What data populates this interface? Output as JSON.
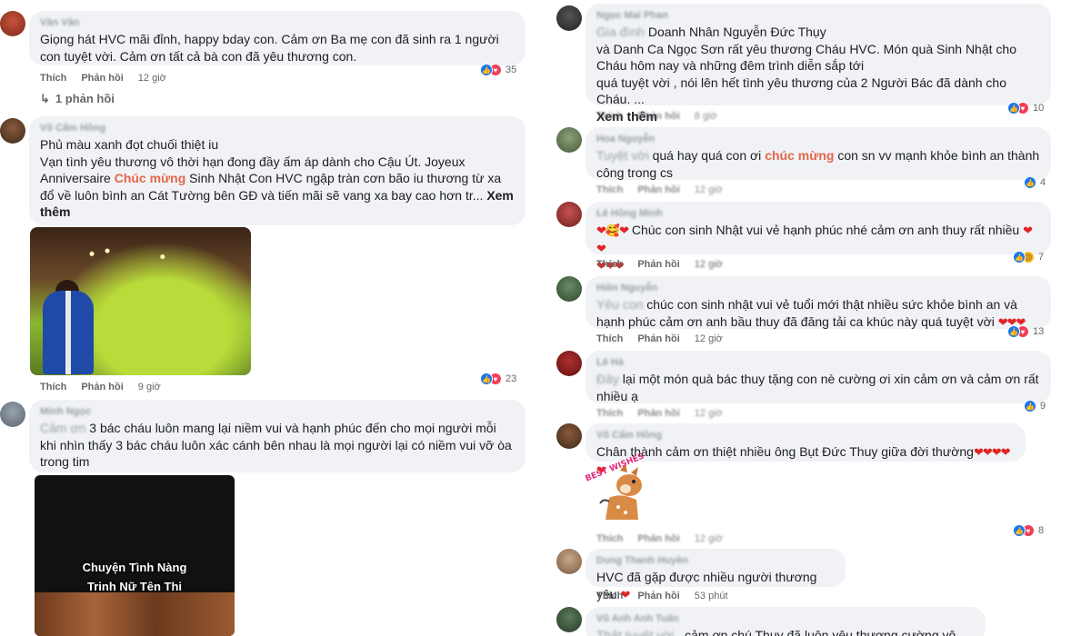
{
  "left_comments": {
    "c1": {
      "author": "Vân Vân",
      "text": "Giọng hát HVC mãi đỉnh, happy bday con. Cảm ơn Ba mẹ con đã sinh ra 1 người con tuyệt vời. Cảm ơn tất cả bà con đã yêu thương con.",
      "like_label": "Thích",
      "reply_label": "Phản hồi",
      "time": "12 giờ",
      "reaction_count": "35",
      "replies_label": "1 phản hồi"
    },
    "c2": {
      "author": "Võ Cẩm Hồng",
      "text_1": "Phủ màu xanh đọt chuối thiệt iu",
      "text_2": "Vạn tình yêu thương vô thời hạn đong đầy ấm áp dành cho Cậu Út. Joyeux Anniversaire ",
      "highlight": "Chúc mừng",
      "text_3": " Sinh Nhật Con HVC ngập tràn cơn bão iu thương từ xa đổ về luôn bình an Cát Tường bên GĐ và tiến mãi sẽ vang xa bay cao hơn tr... ",
      "see_more": "Xem thêm",
      "like_label": "Thích",
      "reply_label": "Phản hồi",
      "time": "9 giờ",
      "reaction_count": "23"
    },
    "c3": {
      "author": "Minh Ngọc",
      "blurred_word": "Cảm ơn",
      "text": " 3 bác cháu luôn mang lại niềm vui và hạnh phúc đến cho mọi người mỗi khi nhìn thấy 3 bác cháu luôn xác cánh bên nhau là mọi người lại có niềm vui vỡ òa trong tim",
      "video_caption_1": "Chuyện Tình Nàng",
      "video_caption_2": "Trinh Nữ Tên Thi"
    }
  },
  "right_comments": {
    "r1": {
      "author": "Ngọc Mai Phan",
      "blurred_prefix": "Gia đình",
      "text_1": " Doanh Nhân Nguyễn Đức Thụy",
      "text_2": "và Danh Ca Ngọc Sơn rất yêu thương Cháu HVC. Món quà Sinh Nhật cho Cháu hôm nay và những đêm trình diễn sắp tới",
      "text_3": "quá tuyệt vời , nói lên hết tình yêu thương của 2 Người Bác đã dành cho Cháu. ...",
      "see_more": "Xem thêm",
      "like_label": "Thích",
      "reply_label": "Phản hồi",
      "time": "8 giờ",
      "reaction_count": "10"
    },
    "r2": {
      "author": "Hoa Nguyễn",
      "blurred_prefix": "Tuyệt vời",
      "text_1": " quá hay quá con ơi ",
      "highlight": "chúc mừng",
      "text_2": " con sn vv mạnh khỏe bình an thành công trong cs",
      "like_label": "Thích",
      "reply_label": "Phản hồi",
      "time": "12 giờ",
      "reaction_count": "4"
    },
    "r3": {
      "author": "Lê Hồng Minh",
      "text": " Chúc con sinh Nhật vui vẻ hạnh phúc nhé cảm ơn anh thuy rất nhiều ",
      "like_label": "Thích",
      "reply_label": "Phản hồi",
      "time": "12 giờ",
      "reaction_count": "7"
    },
    "r4": {
      "author": "Hiền Nguyễn",
      "blurred_prefix": "Yêu con",
      "text": " chúc con sinh nhật vui vẻ tuổi mới thật nhiều sức khỏe bình an và hạnh phúc cảm ơn anh bầu thuy đã đăng tải ca khúc này quá tuyệt vời ",
      "like_label": "Thích",
      "reply_label": "Phản hồi",
      "time": "12 giờ",
      "reaction_count": "13"
    },
    "r5": {
      "author": "Lê Hà",
      "blurred_prefix": "Đây",
      "text": " lại một món quà bác thuy tặng con nè cường ơi xin cảm ơn và cảm ơn rất nhiều ạ",
      "like_label": "Thích",
      "reply_label": "Phản hồi",
      "time": "12 giờ",
      "reaction_count": "9"
    },
    "r6": {
      "author": "Võ Cẩm Hồng",
      "text": "Chân thành cảm ơn thiệt nhiều ông Bụt Đức Thuy giữa đời thường",
      "sticker_text": "BEST WISHES",
      "like_label": "Thích",
      "reply_label": "Phản hồi",
      "time": "12 giờ",
      "reaction_count": "8"
    },
    "r7": {
      "author": "Dung Thanh Huyền",
      "text": "HVC đã gặp được nhiều người thương yêu ",
      "like_label": "Thích",
      "reply_label": "Phản hồi",
      "time": "53 phút"
    },
    "r8": {
      "author": "Vũ Anh Anh Tuấn",
      "blurred_prefix": "Thật tuyệt vời",
      "text": "...cảm ơn chú Thuy đã luôn yêu thương cường vô điều kiện"
    }
  },
  "colors": {
    "bubble": "#f0f2f5",
    "highlight": "#e4664a",
    "like_blue": "#1877f2",
    "love_red": "#f33e58"
  }
}
